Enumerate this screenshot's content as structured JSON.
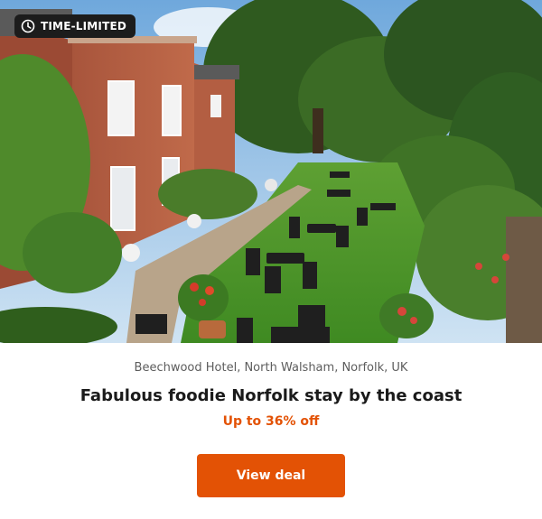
{
  "badge": {
    "label": "TIME-LIMITED",
    "icon": "clock-icon"
  },
  "hero": {
    "icon": "hotel-garden-photo"
  },
  "offer": {
    "location": "Beechwood Hotel, North Walsham, Norfolk, UK",
    "title": "Fabulous foodie Norfolk stay by the coast",
    "discount": "Up to 36% off",
    "cta_label": "View deal"
  },
  "colors": {
    "accent": "#e35205",
    "badge_bg": "#1c1c1c",
    "text_primary": "#1a1a1a",
    "text_secondary": "#5d5d5d"
  }
}
